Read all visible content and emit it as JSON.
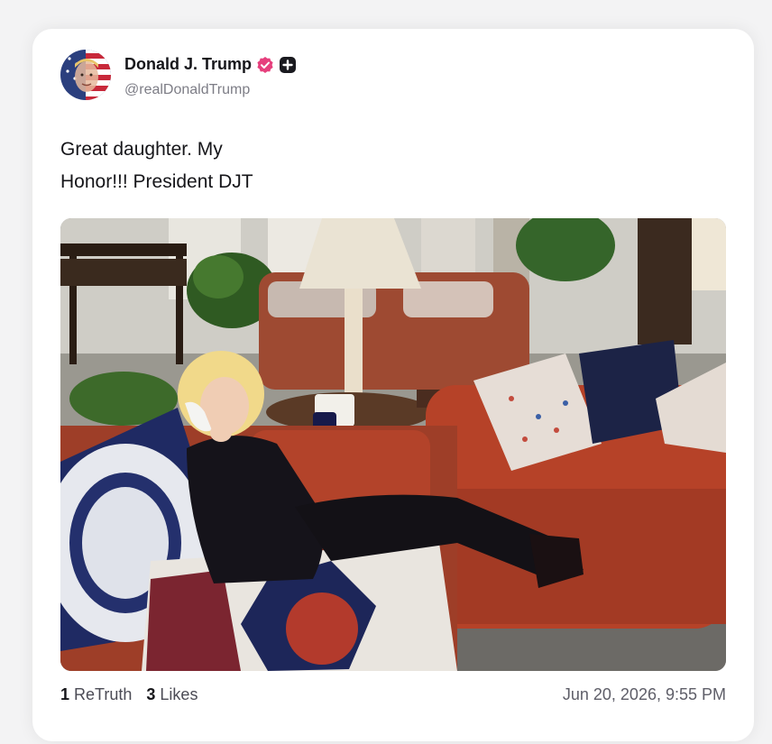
{
  "post": {
    "author_name": "Donald J. Trump",
    "author_handle": "@realDonaldTrump",
    "text_line1": "Great daughter. My",
    "text_line2": "Honor!!! President DJT",
    "retruth_count": "1",
    "retruth_label": "ReTruth",
    "likes_count": "3",
    "likes_label": "Likes",
    "timestamp": "Jun 20, 2026, 9:55 PM"
  },
  "icons": {
    "verified": "verified-badge-icon",
    "plus": "plus-badge-icon"
  },
  "colors": {
    "verified_badge": "#e6407d",
    "page_background": "#f3f3f4",
    "card_background": "#ffffff"
  }
}
